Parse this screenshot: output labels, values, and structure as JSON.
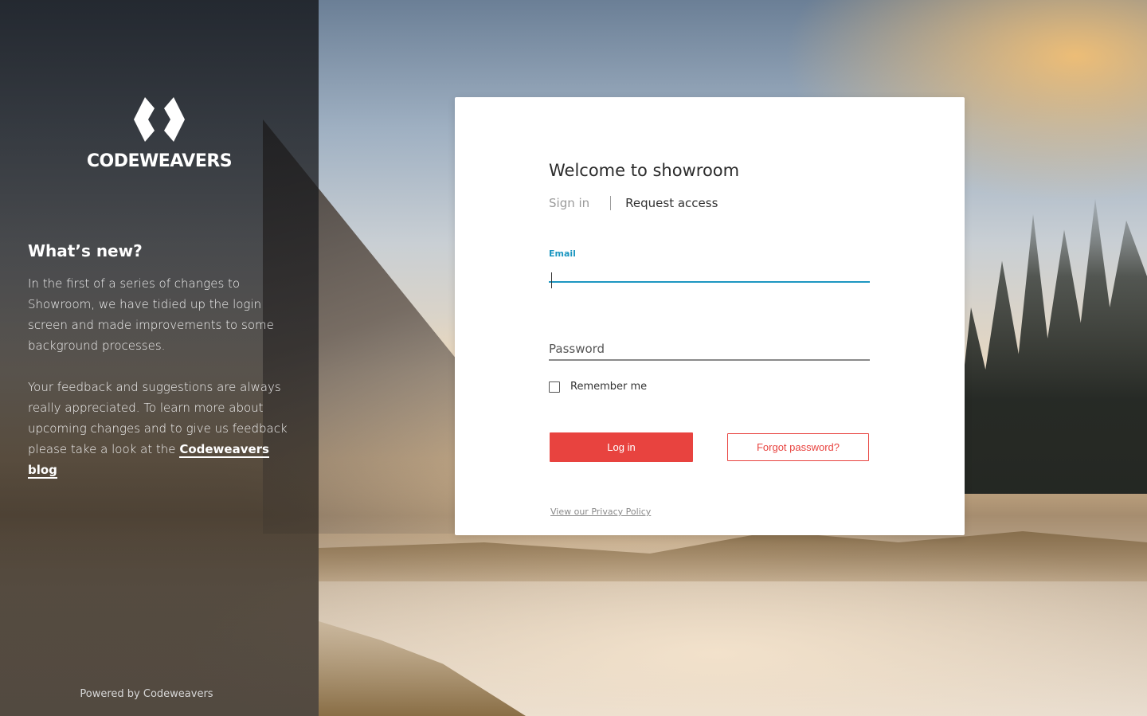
{
  "brand": {
    "name": "CODEWEAVERS"
  },
  "news": {
    "heading": "What’s new?",
    "paragraph1": "In the first of a series of changes to Showroom, we have tidied up the login screen and made improvements to some background processes.",
    "paragraph2_prefix": "Your feedback and suggestions are always really appreciated. To learn more about upcoming changes and to give us feedback please take a look at the ",
    "blog_link": "Codeweavers blog"
  },
  "footer": {
    "powered_by": "Powered by Codeweavers"
  },
  "login": {
    "title": "Welcome to showroom",
    "tab_signin": "Sign in",
    "tab_request": "Request access",
    "email_label": "Email",
    "email_value": "",
    "password_placeholder": "Password",
    "remember_label": "Remember me",
    "remember_checked": false,
    "login_button": "Log in",
    "forgot_button": "Forgot password?",
    "privacy_link": "View our Privacy Policy"
  },
  "icons": {
    "logo": "codeweavers-diamond-logo"
  },
  "colors": {
    "accent_red": "#e8433f",
    "focus_blue": "#1d97c1",
    "panel_dark": "#1a1c20"
  }
}
